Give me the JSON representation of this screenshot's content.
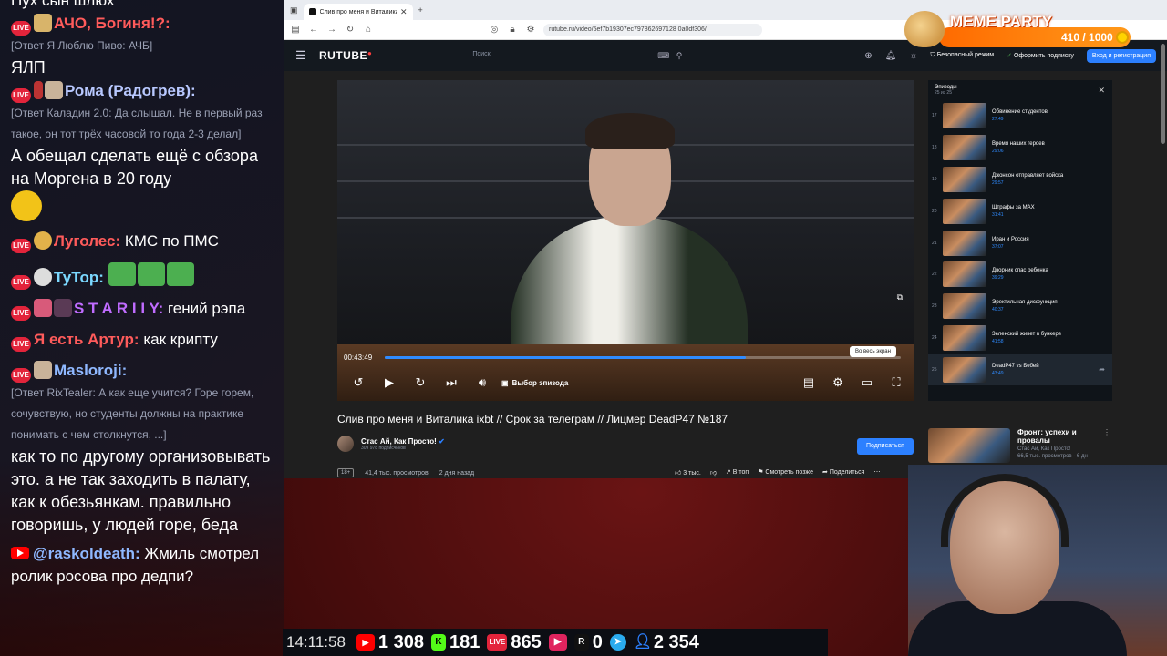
{
  "chat": {
    "messages": [
      {
        "kind": "plain",
        "text": "Пух сын шлюх"
      },
      {
        "kind": "user",
        "platform": "live",
        "nick": "АЧО, Богиня!?:",
        "nick_color": "#ff5b5b",
        "reply": "[Ответ Я Люблю Пиво: АЧБ]",
        "body": "ЯЛП"
      },
      {
        "kind": "user",
        "platform": "live",
        "nick": "Рома (Радогрев):",
        "nick_color": "#b8c8ff",
        "reply": "[Ответ Каладин 2.0: Да слышал. Не в первый раз такое, он тот трёх часовой то года 2-3 делал]",
        "body": "А обещал сделать ещё с обзора на Моргена в 20 году"
      },
      {
        "kind": "user",
        "platform": "live",
        "nick": "Луголес:",
        "nick_color": "#ff5b5b",
        "body": "КМС по ПМС"
      },
      {
        "kind": "user",
        "platform": "live",
        "nick": "ТуТор:",
        "nick_color": "#7bd8ff",
        "body": ""
      },
      {
        "kind": "user",
        "platform": "live",
        "nick": "S T A R I I Y:",
        "nick_color": "#c06cff",
        "body": "гений рэпа"
      },
      {
        "kind": "user",
        "platform": "live",
        "nick": "Я есть Артур:",
        "nick_color": "#ff5b5b",
        "body": "как крипту"
      },
      {
        "kind": "user",
        "platform": "live",
        "nick": "Masloroji:",
        "nick_color": "#8fb8ff",
        "reply": "[Ответ RixTealer: А как еще учится? Горе горем, сочувствую, но студенты должны на практике понимать с чем столкнутся, ...]",
        "body": "как то по другому организовывать это. а не так заходить в палату, как к обезьянкам. правильно говоришь, у людей горе, беда"
      },
      {
        "kind": "user",
        "platform": "youtube",
        "nick": "@raskoldeath:",
        "nick_color": "#8fb8ff",
        "body": "Жмиль смотрел ролик росова про дедпи?"
      }
    ]
  },
  "browser": {
    "tab_title": "Слив про меня и Виталика ixbt",
    "url": "rutube.ru/video/5ef7b19307ec797862697128 0a0df306/",
    "search_placeholder": "Поиск",
    "logo": "RUTUBE",
    "safe_mode": "Безопасный режим",
    "subscribe_premium": "Оформить подписку",
    "login": "Вход и регистрация"
  },
  "player": {
    "time": "00:43:49",
    "progress": 0.7,
    "episode_button": "Выбор эпизода",
    "tooltip": "Во весь экран"
  },
  "episodes": {
    "header": "Эпизоды",
    "count": "25 из 25",
    "items": [
      {
        "num": "17",
        "title": "Обвинение студентов",
        "dur": "27:49"
      },
      {
        "num": "18",
        "title": "Время наших героев",
        "dur": "29:06"
      },
      {
        "num": "19",
        "title": "Джонсон отправляет войска",
        "dur": "29:57"
      },
      {
        "num": "20",
        "title": "Штрафы за MAX",
        "dur": "31:41"
      },
      {
        "num": "21",
        "title": "Иран и Россия",
        "dur": "37:07"
      },
      {
        "num": "22",
        "title": "Дворник спас ребенка",
        "dur": "39:29"
      },
      {
        "num": "23",
        "title": "Эректильная дисфункция",
        "dur": "40:37"
      },
      {
        "num": "24",
        "title": "Зеленский живет в бункере",
        "dur": "41:58"
      },
      {
        "num": "25",
        "title": "DeadP47 vs Бебей",
        "dur": "43:49"
      }
    ]
  },
  "video": {
    "title": "Слив про меня и Виталика ixbt // Срок за телеграм // Лицмер DeadP47 №187",
    "channel": "Стас Ай, Как Просто!",
    "subscribers": "309 978 подписчиков",
    "subscribe": "Подписаться",
    "age": "18+",
    "views": "41,4 тыс. просмотров",
    "date": "2 дня назад",
    "likes": "3 тыс.",
    "to_top": "В топ",
    "watch_later": "Смотреть позже",
    "share": "Поделиться"
  },
  "recommendation": {
    "title": "Фронт: успехи и провалы",
    "channel": "Стас Ай, Как Просто!",
    "views": "66,5 тыс. просмотров · 6 дн"
  },
  "meme_party": {
    "title": "MEME PARTY",
    "count": "410 / 1000"
  },
  "stats": {
    "time": "14:11:58",
    "youtube": "1 308",
    "kick": "181",
    "live": "865",
    "rutube": "0",
    "telegram": "2 354"
  }
}
